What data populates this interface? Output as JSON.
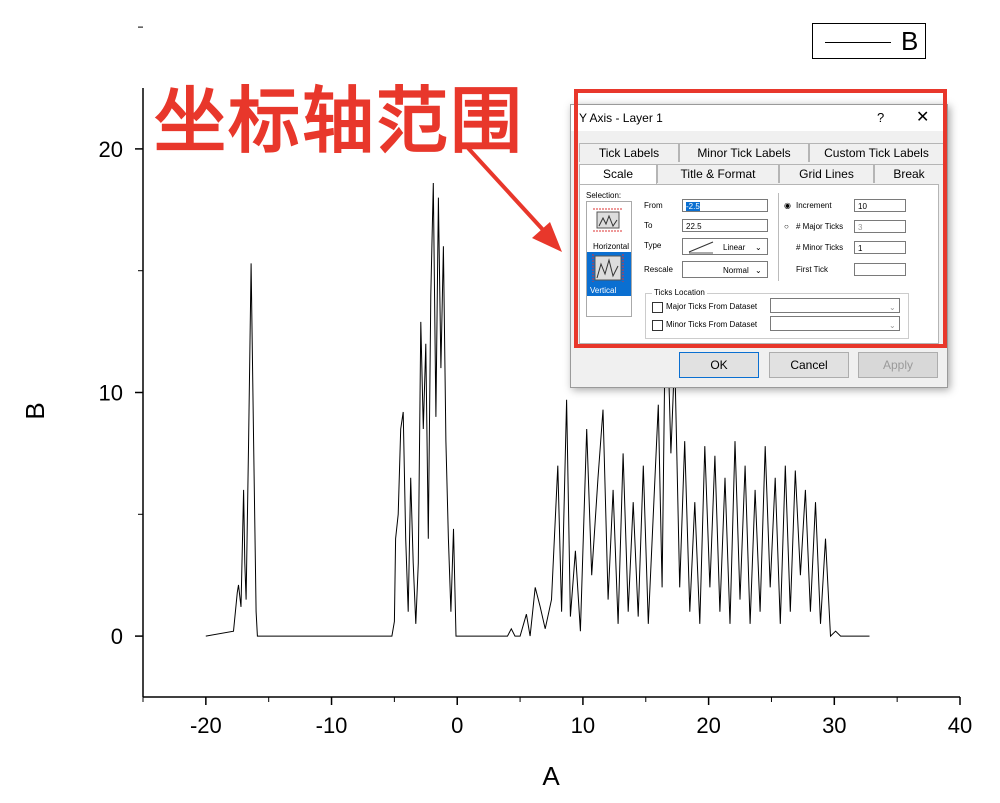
{
  "chart_data": {
    "type": "line",
    "xlabel": "A",
    "ylabel": "B",
    "xlim": [
      -25,
      40
    ],
    "ylim": [
      -2.5,
      22.5
    ],
    "x_ticks": [
      -20,
      -10,
      0,
      10,
      20,
      30,
      40
    ],
    "y_ticks": [
      0,
      10,
      20
    ],
    "grid": false,
    "legend_position": "top-right",
    "series": [
      {
        "name": "B",
        "x": [
          -20,
          -17.8,
          -17.5,
          -17.4,
          -17.2,
          -17.0,
          -16.9,
          -16.8,
          -16.6,
          -16.4,
          -16.2,
          -16.0,
          -15.9,
          -15.7,
          -5.2,
          -5.0,
          -4.9,
          -4.7,
          -4.5,
          -4.3,
          -4.1,
          -3.9,
          -3.7,
          -3.5,
          -3.3,
          -3.1,
          -2.9,
          -2.7,
          -2.5,
          -2.3,
          -2.1,
          -1.9,
          -1.7,
          -1.5,
          -1.3,
          -1.1,
          -0.9,
          -0.7,
          -0.5,
          -0.3,
          -0.1,
          4.0,
          4.3,
          4.6,
          5.0,
          5.5,
          5.8,
          6.2,
          6.6,
          7.0,
          7.5,
          8.0,
          8.3,
          8.7,
          9.0,
          9.4,
          9.8,
          10.3,
          10.7,
          11.2,
          11.6,
          12.0,
          12.4,
          12.8,
          13.2,
          13.6,
          14.0,
          14.4,
          14.8,
          15.2,
          15.6,
          16.0,
          16.3,
          16.6,
          17.0,
          17.3,
          17.7,
          18.1,
          18.5,
          18.9,
          19.3,
          19.7,
          20.1,
          20.5,
          20.9,
          21.3,
          21.7,
          22.1,
          22.5,
          22.9,
          23.3,
          23.7,
          24.1,
          24.5,
          24.9,
          25.3,
          25.7,
          26.1,
          26.5,
          26.9,
          27.3,
          27.7,
          28.1,
          28.5,
          28.9,
          29.3,
          29.7,
          30.1,
          30.5,
          31.0,
          32.8
        ],
        "y": [
          0,
          0.2,
          1.8,
          2.1,
          1.2,
          6.0,
          3.0,
          1.5,
          8.0,
          15.3,
          8.0,
          1.0,
          0,
          0,
          0,
          0.6,
          4.0,
          5.0,
          8.5,
          9.2,
          4.0,
          1.0,
          6.5,
          3.0,
          0.5,
          3.0,
          12.9,
          8.5,
          12.0,
          4.0,
          14.0,
          18.6,
          9.0,
          18.0,
          11.0,
          16.0,
          8.0,
          4.0,
          1.0,
          4.4,
          0,
          0,
          0.3,
          0,
          0,
          0.9,
          0,
          2.0,
          1.2,
          0.3,
          1.5,
          7.0,
          1.0,
          9.7,
          0.8,
          3.5,
          0.2,
          8.5,
          2.5,
          6.5,
          9.3,
          1.5,
          6.0,
          0.5,
          7.5,
          1.0,
          5.5,
          0.8,
          7.0,
          0.5,
          5.0,
          9.5,
          2.0,
          15.0,
          7.5,
          11.5,
          2.0,
          8.0,
          1.0,
          5.5,
          0.5,
          7.8,
          2.0,
          7.4,
          1.0,
          6.5,
          0.5,
          8.0,
          1.5,
          7.0,
          0.5,
          6.0,
          1.0,
          7.8,
          2.0,
          6.5,
          0.5,
          7.0,
          1.0,
          6.8,
          2.5,
          6.0,
          1.0,
          5.5,
          0.5,
          4.0,
          0,
          0.2,
          0,
          0,
          0
        ]
      }
    ]
  },
  "legend": {
    "label": "B"
  },
  "annotation": {
    "text": "坐标轴范围",
    "color": "#e8372b"
  },
  "dialog": {
    "title": "Y Axis - Layer 1",
    "help_label": "?",
    "close_label": "✕",
    "tabs_row1": [
      "Tick Labels",
      "Minor Tick Labels",
      "Custom Tick Labels"
    ],
    "tabs_row2": [
      "Scale",
      "Title & Format",
      "Grid Lines",
      "Break"
    ],
    "active_tab": "Scale",
    "selection_label": "Selection:",
    "selection_items": [
      "Horizontal",
      "Vertical"
    ],
    "selected_item": "Vertical",
    "from_label": "From",
    "from_value": "-2.5",
    "to_label": "To",
    "to_value": "22.5",
    "type_label": "Type",
    "type_value": "Linear",
    "rescale_label": "Rescale",
    "rescale_value": "Normal",
    "increment_label": "Increment",
    "increment_value": "10",
    "major_ticks_label": "# Major Ticks",
    "major_ticks_value": "3",
    "minor_ticks_label": "# Minor Ticks",
    "minor_ticks_value": "1",
    "first_tick_label": "First Tick",
    "first_tick_value": "",
    "ticks_location_label": "Ticks Location",
    "major_from_dataset_label": "Major Ticks From Dataset",
    "minor_from_dataset_label": "Minor Ticks From Dataset",
    "ok_label": "OK",
    "cancel_label": "Cancel",
    "apply_label": "Apply"
  },
  "colors": {
    "highlight": "#e8372b",
    "selected": "#0a6fd1"
  }
}
